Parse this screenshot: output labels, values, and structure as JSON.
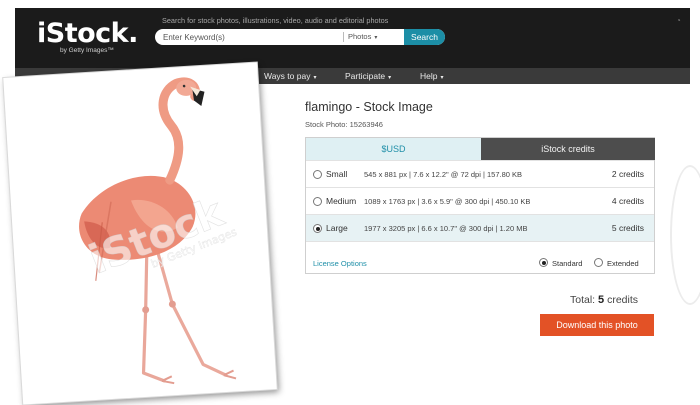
{
  "header": {
    "logo": "iStock.",
    "logo_sub": "by Getty Images™",
    "search_hint": "Search for stock photos, illustrations, video, audio and editorial photos",
    "search_placeholder": "Enter Keyword(s)",
    "search_filter": "Photos",
    "search_button": "Search"
  },
  "nav": {
    "items": [
      "Ways to pay",
      "Participate",
      "Help"
    ]
  },
  "photo": {
    "watermark": "iStock",
    "watermark_sub": "by Getty Images"
  },
  "product": {
    "title": "flamingo - Stock Image",
    "stock_id": "Stock Photo: 15263946"
  },
  "pricing": {
    "tabs": [
      "$USD",
      "iStock credits"
    ],
    "active_tab": "iStock credits",
    "sizes": [
      {
        "name": "Small",
        "dims": "545 x 881 px  |  7.6 x 12.2\" @ 72 dpi  |  157.80 KB",
        "credits": "2 credits",
        "selected": false
      },
      {
        "name": "Medium",
        "dims": "1089 x 1763 px  |  3.6 x 5.9\" @ 300 dpi  |  450.10 KB",
        "credits": "4 credits",
        "selected": false
      },
      {
        "name": "Large",
        "dims": "1977 x 3205 px  |  6.6 x 10.7\" @ 300 dpi  |  1.20 MB",
        "credits": "5 credits",
        "selected": true
      }
    ],
    "license_link": "License Options",
    "license_options": [
      "Standard",
      "Extended"
    ],
    "license_selected": "Standard"
  },
  "summary": {
    "total_label": "Total:",
    "total_value": "5",
    "total_unit": "credits",
    "download_button": "Download this photo"
  },
  "colors": {
    "header_bg": "#1b1b1b",
    "search_button": "#1c8ea6",
    "download_button": "#e35226",
    "usd_tab_text": "#1f8fa8"
  }
}
